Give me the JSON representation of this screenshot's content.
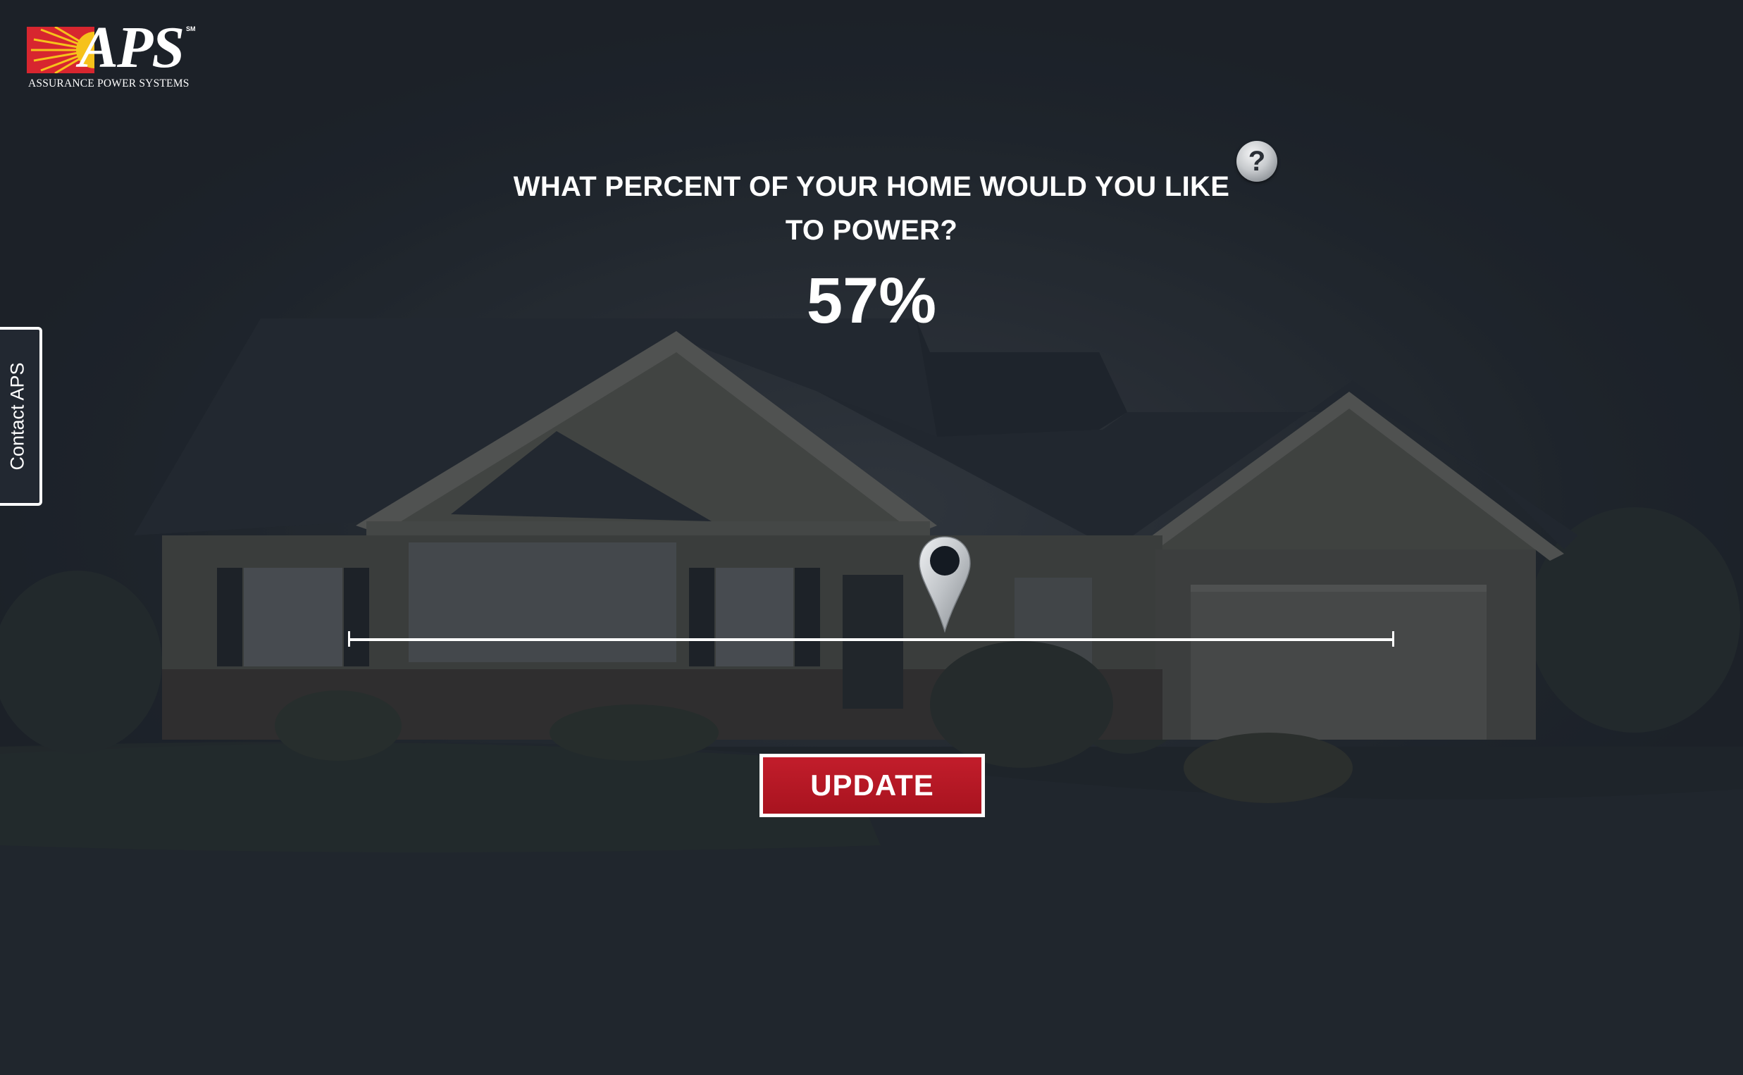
{
  "logo": {
    "name": "APS",
    "mark": "SM",
    "tagline": "ASSURANCE POWER SYSTEMS",
    "brand_red": "#d7262f",
    "brand_yellow": "#f6c21b"
  },
  "contact_tab": {
    "label": "Contact APS"
  },
  "question": {
    "line1": "WHAT PERCENT OF YOUR HOME WOULD YOU LIKE",
    "line2": "TO POWER?"
  },
  "help_icon": {
    "glyph": "?",
    "icon": "help-icon"
  },
  "power": {
    "display": "57%",
    "value": 57,
    "min": 0,
    "max": 100
  },
  "update_button": {
    "label": "UPDATE",
    "color": "#b5162a"
  }
}
